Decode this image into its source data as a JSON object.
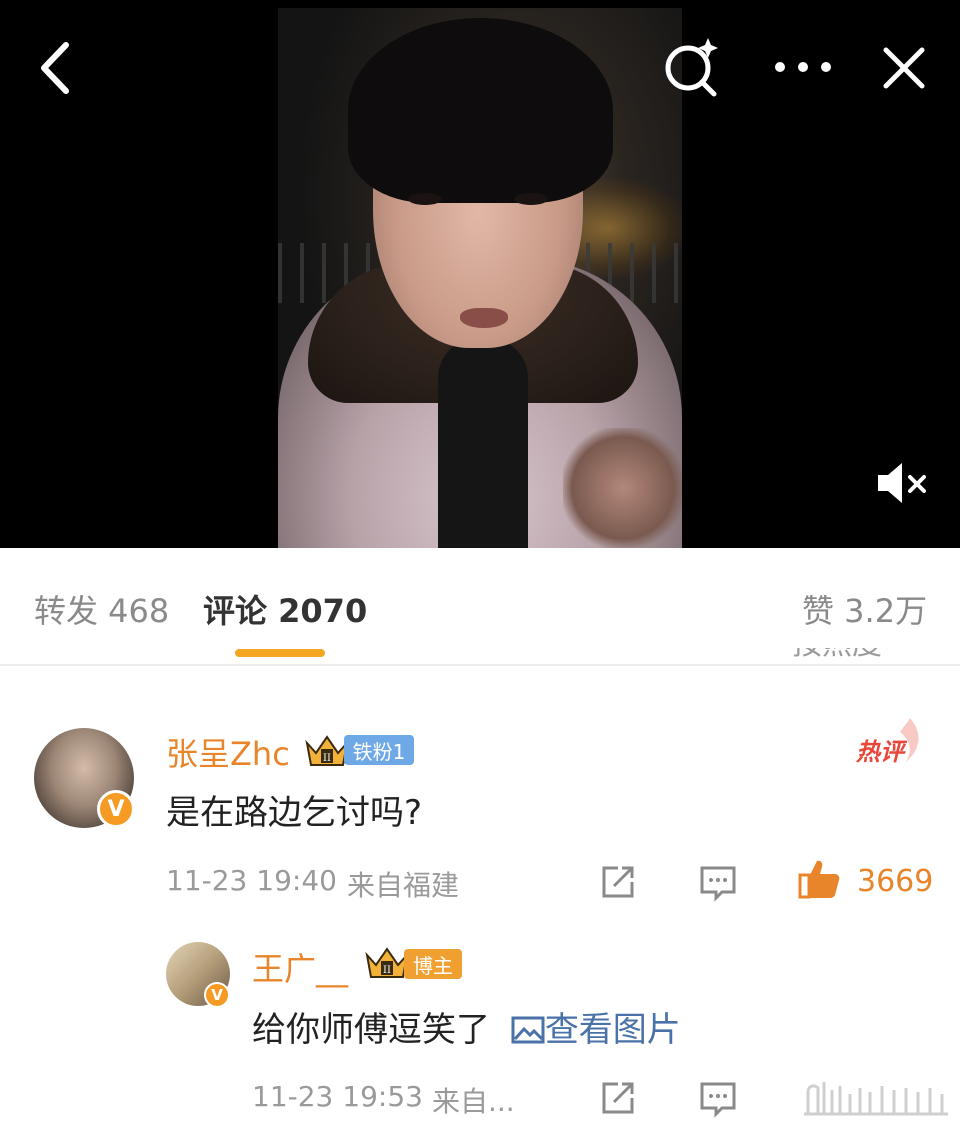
{
  "video": {
    "muted": true
  },
  "tabs": [
    {
      "label": "转发 468",
      "active": false
    },
    {
      "label": "评论 2070",
      "active": true
    },
    {
      "label": "赞 3.2万",
      "active": false
    }
  ],
  "sort_label_partial": "按热度",
  "comments": [
    {
      "username": "张呈Zhc",
      "badge": "铁粉1",
      "tag": "热评",
      "text": "是在路边乞讨吗?",
      "time": "11-23 19:40",
      "location": "来自福建",
      "likes": "3669"
    }
  ],
  "replies": [
    {
      "username": "王广__",
      "badge": "博主",
      "text": "给你师傅逗笑了",
      "link": "查看图片",
      "time": "11-23 19:53",
      "location": "来自..."
    }
  ],
  "colors": {
    "accent": "#f5a623",
    "username": "#e8852a",
    "link": "#4a72a8",
    "fan_badge": "#6fa8e6",
    "hot": "#e8473a"
  },
  "icons": [
    "back-icon",
    "search-sparkle-icon",
    "more-icon",
    "close-icon",
    "mute-icon",
    "share-icon",
    "comment-icon",
    "like-icon",
    "crown-icon",
    "verified-icon",
    "image-icon"
  ]
}
